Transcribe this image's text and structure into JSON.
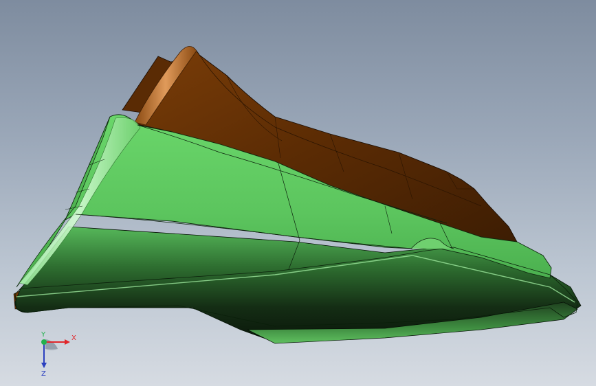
{
  "viewport": {
    "background_top": "#7e8c9f",
    "background_bottom": "#d6dbe2"
  },
  "model": {
    "parts": [
      {
        "name": "upper-part",
        "color": "#6b3507",
        "highlight": "#c0763a"
      },
      {
        "name": "lower-part",
        "color": "#5cc55e",
        "shadow": "#0c1a0c"
      }
    ]
  },
  "triad": {
    "x_label": "X",
    "y_label": "Y",
    "z_label": "Z",
    "x_color": "#e0262a",
    "y_color": "#22b14c",
    "z_color": "#2a3fbf"
  }
}
